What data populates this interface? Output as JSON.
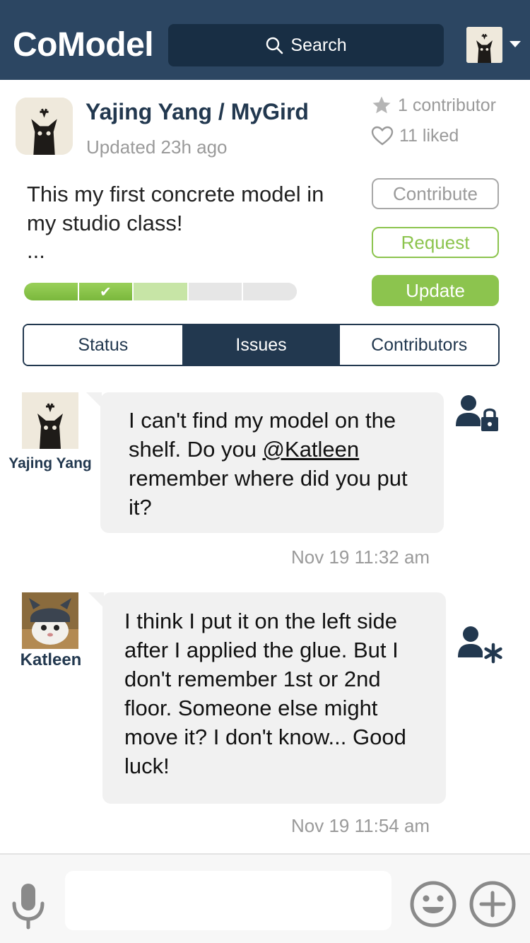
{
  "header": {
    "brand": "CoModel",
    "search_label": "Search"
  },
  "project": {
    "title": "Yajing Yang / MyGird",
    "updated": "Updated 23h ago",
    "contributors": "1 contributor",
    "likes": "11 liked",
    "description": "This my first concrete model in my studio class!",
    "more": "...",
    "progress": {
      "segments": 5,
      "completed": 2,
      "in_progress": 1
    }
  },
  "actions": {
    "contribute": "Contribute",
    "request": "Request",
    "update": "Update"
  },
  "tabs": [
    {
      "label": "Status",
      "active": false
    },
    {
      "label": "Issues",
      "active": true
    },
    {
      "label": "Contributors",
      "active": false
    }
  ],
  "messages": [
    {
      "author": "Yajing Yang",
      "text_before": "I can't find my model on the shelf. Do you ",
      "mention": "@Katleen",
      "text_after": " remember where did you put it?",
      "time": "Nov 19 11:32 am",
      "role_icon": "user-lock-icon"
    },
    {
      "author": "Katleen",
      "text": "I think I put it on the left side after I applied the glue. But I don't remember 1st or 2nd floor. Someone else might move it? I don't know... Good luck!",
      "time": "Nov 19 11:54 am",
      "role_icon": "user-asterisk-icon"
    }
  ],
  "composer": {
    "value": "",
    "icons": [
      "microphone-icon",
      "smiley-icon",
      "plus-circle-icon"
    ]
  },
  "colors": {
    "navy": "#2c4662",
    "navy_dark": "#22384f",
    "green": "#8cc44e",
    "bubble": "#f1f1f1",
    "muted": "#9a9a9a"
  }
}
